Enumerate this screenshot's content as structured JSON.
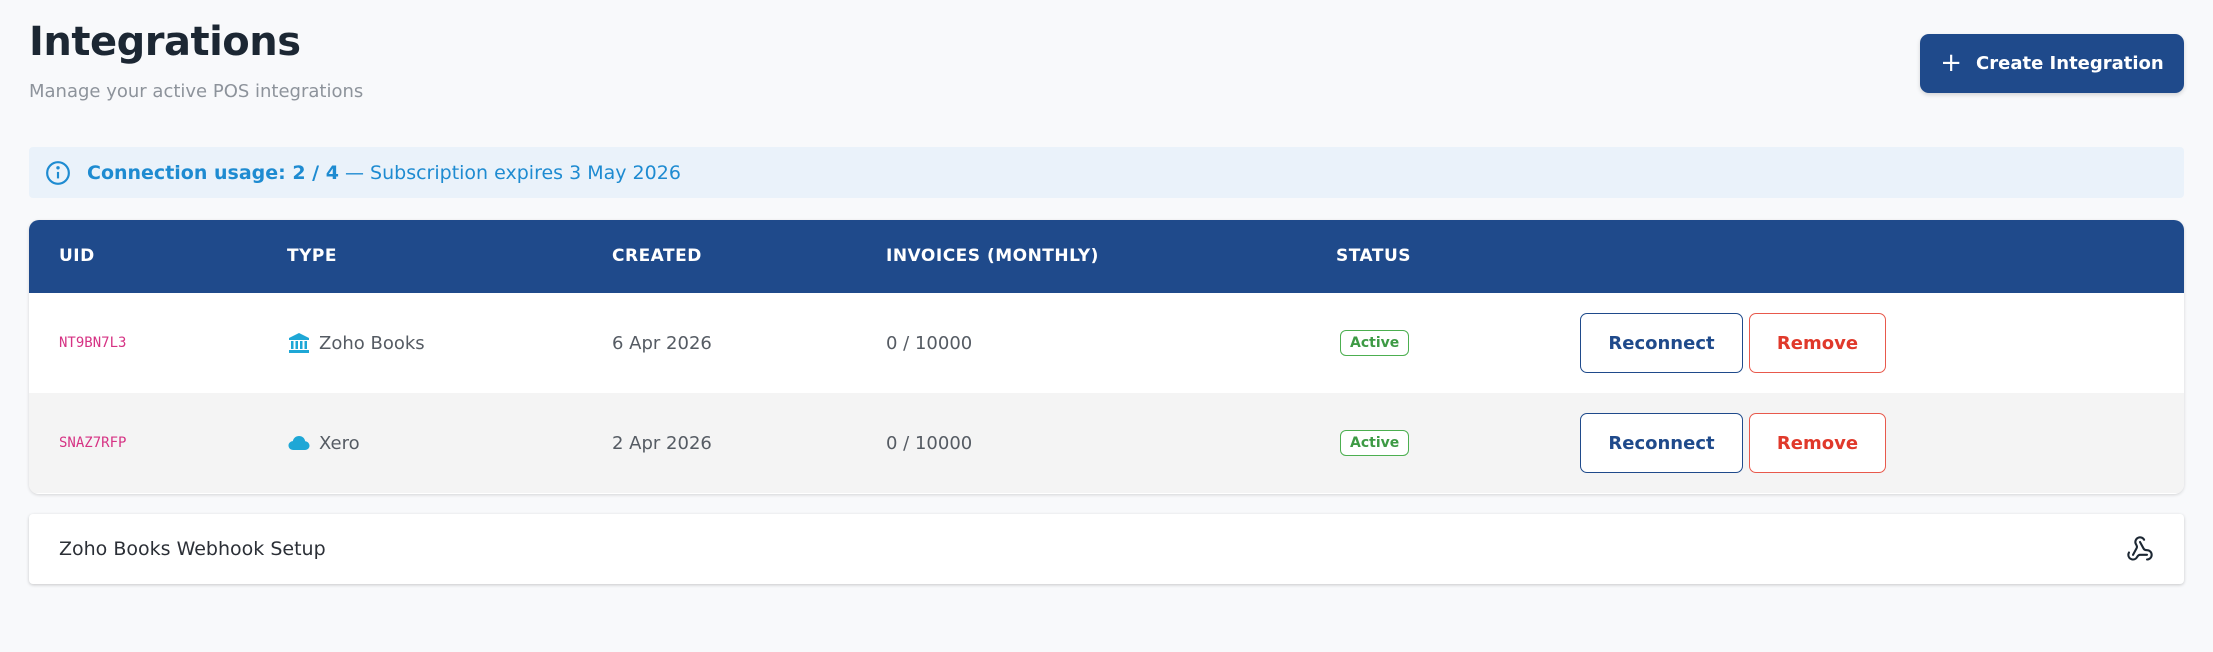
{
  "header": {
    "title": "Integrations",
    "subtitle": "Manage your active POS integrations",
    "create_button": {
      "icon": "plus-icon",
      "label": "Create Integration"
    }
  },
  "usage_banner": {
    "icon": "info-icon",
    "usage_text": "Connection usage: 2 / 4",
    "expiry_text": " — Subscription expires 3 May 2026"
  },
  "table": {
    "columns": [
      "UID",
      "TYPE",
      "CREATED",
      "INVOICES (MONTHLY)",
      "STATUS"
    ],
    "rows": [
      {
        "uid": "NT9BN7L3",
        "type": "Zoho Books",
        "type_icon": "bank-icon",
        "created": "6 Apr 2026",
        "invoices": "0 / 10000",
        "status": "Active",
        "reconnect_label": "Reconnect",
        "remove_label": "Remove"
      },
      {
        "uid": "SNAZ7RFP",
        "type": "Xero",
        "type_icon": "cloud-icon",
        "created": "2 Apr 2026",
        "invoices": "0 / 10000",
        "status": "Active",
        "reconnect_label": "Reconnect",
        "remove_label": "Remove"
      }
    ]
  },
  "webhook_panel": {
    "title": "Zoho Books Webhook Setup",
    "icon": "webhook-icon"
  },
  "colors": {
    "primary": "#1f4a8b",
    "info": "#1e8bd1",
    "info_bg": "#eaf2fa",
    "success": "#3d9a44",
    "danger": "#e0392b",
    "uid_pink": "#d63384",
    "type_icon": "#1ea7d6"
  }
}
